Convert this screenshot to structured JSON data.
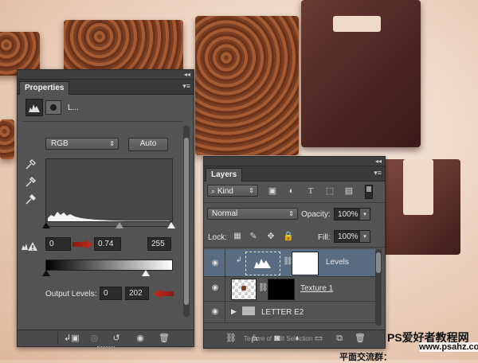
{
  "properties_panel": {
    "tab_label": "Properties",
    "adjustment_label": "L...",
    "preset_value": "RGB",
    "auto_label": "Auto",
    "input_black": "0",
    "input_gamma": "0.74",
    "input_white": "255",
    "output_label": "Output Levels:",
    "output_black": "0",
    "output_white": "202"
  },
  "layers_panel": {
    "tab_label": "Layers",
    "kind_label": "Kind",
    "blend_mode": "Normal",
    "opacity_label": "Opacity:",
    "opacity_value": "100%",
    "lock_label": "Lock:",
    "fill_label": "Fill:",
    "fill_value": "100%",
    "layers": [
      {
        "name": "Levels"
      },
      {
        "name": "Texture 1"
      },
      {
        "name": "LETTER E2"
      }
    ]
  },
  "watermark": {
    "line1": "PS爱好者教程网",
    "line2": "www.psahz.com",
    "line3": "平面交流群：",
    "partial_text": "Texture  of  Edit  Selection"
  },
  "colors": {
    "panel_bg": "#535353",
    "selected_layer": "#5a6c82",
    "red_arrow": "#c42a1c"
  }
}
